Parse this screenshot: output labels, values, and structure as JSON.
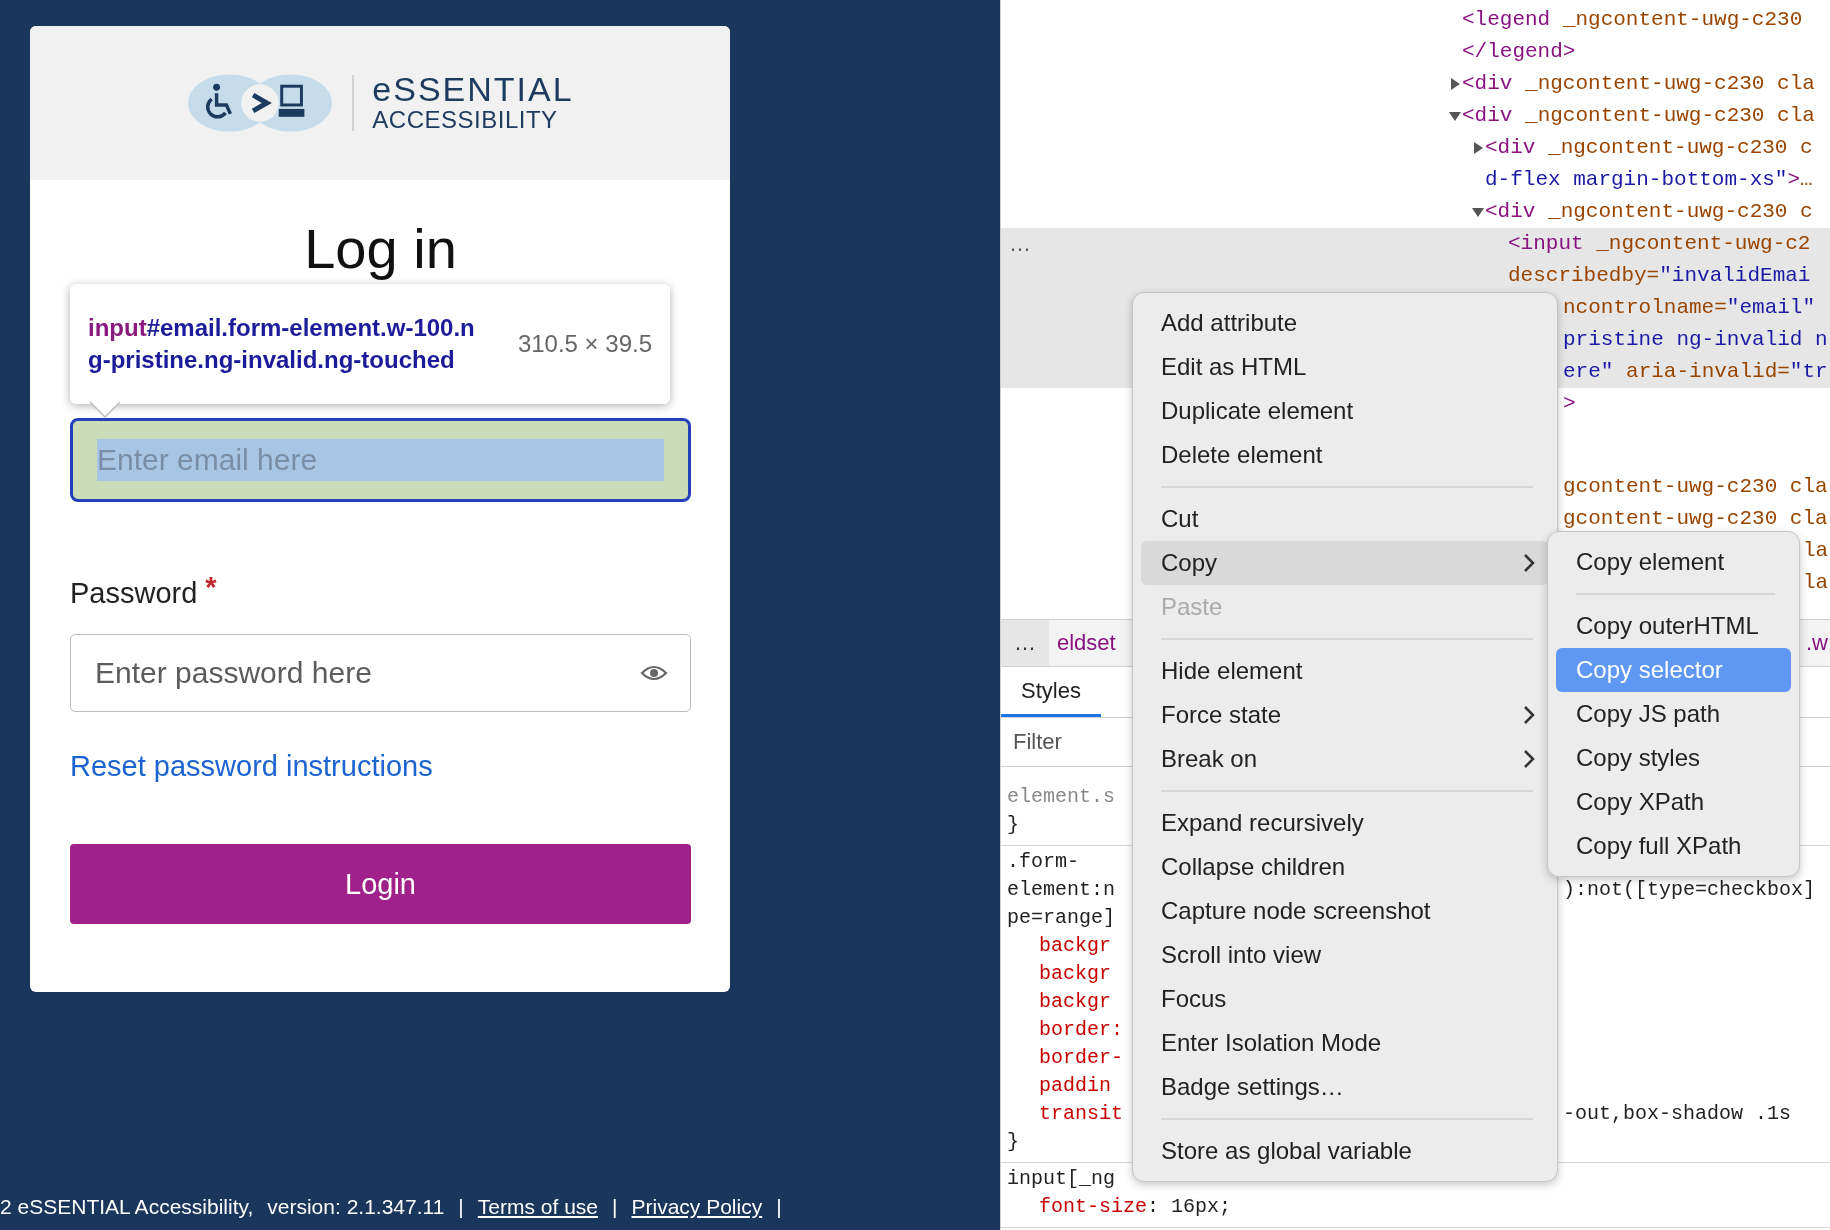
{
  "login_page": {
    "logo": {
      "line_1": "eSSENTIAL",
      "line_2": "ACCESSIBILITY"
    },
    "title": "Log in",
    "inspect_tooltip": {
      "tag": "input",
      "selector": "#email.form-element.w-100.ng-pristine.ng-invalid.ng-touched",
      "size": "310.5 × 39.5"
    },
    "email_field": {
      "placeholder": "Enter email here",
      "inspected": true
    },
    "password": {
      "label": "Password",
      "required_mark": "*",
      "placeholder": "Enter password here"
    },
    "reset_link": "Reset password instructions",
    "login_button": "Login",
    "footer": [
      {
        "kind": "text",
        "text": "2 eSSENTIAL Accessibility,"
      },
      {
        "kind": "text",
        "text": "version: 2.1.347.11"
      },
      {
        "kind": "separator",
        "text": "|"
      },
      {
        "kind": "link",
        "text": "Terms of use"
      },
      {
        "kind": "separator",
        "text": "|"
      },
      {
        "kind": "link",
        "text": "Privacy Policy"
      },
      {
        "kind": "separator",
        "text": "|"
      }
    ]
  },
  "devtools": {
    "elements_tree": [
      {
        "selected": false,
        "lines": [
          {
            "text": "<legend _ngcontent-uwg-c230",
            "kind": "full"
          },
          {
            "text": "</legend>",
            "kind": "full"
          }
        ]
      },
      {
        "selected": false,
        "expanded": false,
        "lines": [
          {
            "text": "<div _ngcontent-uwg-c230 cla",
            "kind": "full"
          }
        ]
      },
      {
        "selected": false,
        "expanded": true,
        "lines": [
          {
            "text": "<div _ngcontent-uwg-c230 cla",
            "kind": "full"
          }
        ],
        "children": [
          {
            "selected": false,
            "expanded": false,
            "lines": [
              {
                "text": "<div _ngcontent-uwg-c230 c",
                "kind": "full"
              },
              {
                "text": "d-flex margin-bottom-xs\">…",
                "kind": "full",
                "in_value": true
              }
            ]
          },
          {
            "selected": false,
            "expanded": true,
            "lines": [
              {
                "text": "<div _ngcontent-uwg-c230 c",
                "kind": "full"
              }
            ],
            "children": [
              {
                "selected": true,
                "gutter": "…",
                "lines": [
                  {
                    "text": "<input _ngcontent-uwg-c2",
                    "kind": "full"
                  },
                  {
                    "text": "describedby=\"invalidEmai",
                    "kind": "full"
                  },
                  {
                    "text": "ncontrolname=\"email\"",
                    "kind": "beside-menu"
                  },
                  {
                    "text": "pristine ng-invalid n",
                    "kind": "beside-menu",
                    "in_value": true
                  },
                  {
                    "text": "ere\" aria-invalid=\"tr",
                    "kind": "beside-menu",
                    "in_value": true
                  }
                ]
              },
              {
                "selected": false,
                "lines": [
                  {
                    "text": ">",
                    "kind": "beside-menu"
                  }
                ]
              }
            ]
          }
        ]
      }
    ],
    "trailing_lines": [
      {
        "text": "gcontent-uwg-c230 cla",
        "kind": "beside-menu"
      },
      {
        "text": "gcontent-uwg-c230 cla",
        "kind": "beside-menu"
      },
      {
        "text": "la",
        "kind": "beside-submenu"
      },
      {
        "text": "la",
        "kind": "beside-submenu"
      }
    ],
    "breadcrumb": {
      "ellipsis": "…",
      "path_tail": "eldset",
      "beside": ".w"
    },
    "tabs": [
      {
        "label": "Styles",
        "selected": true
      }
    ],
    "filter": {
      "placeholder": "Filter"
    },
    "rules": [
      {
        "lines": [
          {
            "kind": "element-style",
            "text": "element.s"
          },
          {
            "kind": "brace",
            "text": "}"
          }
        ]
      },
      {
        "lines": [
          {
            "kind": "selector",
            "text": ".form-"
          },
          {
            "kind": "selector",
            "text": "element:n",
            "beside": "):not([type=checkbox]"
          },
          {
            "kind": "selector",
            "text": "pe=range]"
          },
          {
            "kind": "property",
            "text": "backgr"
          },
          {
            "kind": "property",
            "text": "backgr"
          },
          {
            "kind": "property",
            "text": "backgr"
          },
          {
            "kind": "property",
            "text": "border:"
          },
          {
            "kind": "property",
            "text": "border-"
          },
          {
            "kind": "property",
            "text": "paddin"
          },
          {
            "kind": "property",
            "text": "transit",
            "beside": "-out,box-shadow .1s"
          },
          {
            "kind": "brace",
            "text": "}"
          }
        ]
      },
      {
        "lines": [
          {
            "kind": "selector",
            "text": "input[_ng"
          },
          {
            "kind": "declaration",
            "property": "font-size",
            "rest": ": 16px;"
          }
        ]
      }
    ]
  },
  "context_menu": {
    "groups": [
      [
        {
          "label": "Add attribute",
          "selected": false,
          "disabled": false,
          "submenu": false
        },
        {
          "label": "Edit as HTML",
          "selected": false,
          "disabled": false,
          "submenu": false
        },
        {
          "label": "Duplicate element",
          "selected": false,
          "disabled": false,
          "submenu": false
        },
        {
          "label": "Delete element",
          "selected": false,
          "disabled": false,
          "submenu": false
        }
      ],
      [
        {
          "label": "Cut",
          "selected": false,
          "disabled": false,
          "submenu": false
        },
        {
          "label": "Copy",
          "selected": true,
          "disabled": false,
          "submenu": true
        },
        {
          "label": "Paste",
          "selected": false,
          "disabled": true,
          "submenu": false
        }
      ],
      [
        {
          "label": "Hide element",
          "selected": false,
          "disabled": false,
          "submenu": false
        },
        {
          "label": "Force state",
          "selected": false,
          "disabled": false,
          "submenu": true
        },
        {
          "label": "Break on",
          "selected": false,
          "disabled": false,
          "submenu": true
        }
      ],
      [
        {
          "label": "Expand recursively",
          "selected": false,
          "disabled": false,
          "submenu": false
        },
        {
          "label": "Collapse children",
          "selected": false,
          "disabled": false,
          "submenu": false
        },
        {
          "label": "Capture node screenshot",
          "selected": false,
          "disabled": false,
          "submenu": false
        },
        {
          "label": "Scroll into view",
          "selected": false,
          "disabled": false,
          "submenu": false
        },
        {
          "label": "Focus",
          "selected": false,
          "disabled": false,
          "submenu": false
        },
        {
          "label": "Enter Isolation Mode",
          "selected": false,
          "disabled": false,
          "submenu": false
        },
        {
          "label": "Badge settings…",
          "selected": false,
          "disabled": false,
          "submenu": false
        }
      ],
      [
        {
          "label": "Store as global variable",
          "selected": false,
          "disabled": false,
          "submenu": false
        }
      ]
    ]
  },
  "copy_submenu": {
    "groups": [
      [
        {
          "label": "Copy element",
          "selected": false,
          "disabled": false,
          "submenu": false
        }
      ],
      [
        {
          "label": "Copy outerHTML",
          "selected": false,
          "disabled": false,
          "submenu": false
        },
        {
          "label": "Copy selector",
          "selected": true,
          "disabled": false,
          "submenu": false
        },
        {
          "label": "Copy JS path",
          "selected": false,
          "disabled": false,
          "submenu": false
        },
        {
          "label": "Copy styles",
          "selected": false,
          "disabled": false,
          "submenu": false
        },
        {
          "label": "Copy XPath",
          "selected": false,
          "disabled": false,
          "submenu": false
        },
        {
          "label": "Copy full XPath",
          "selected": false,
          "disabled": false,
          "submenu": false
        }
      ]
    ]
  }
}
